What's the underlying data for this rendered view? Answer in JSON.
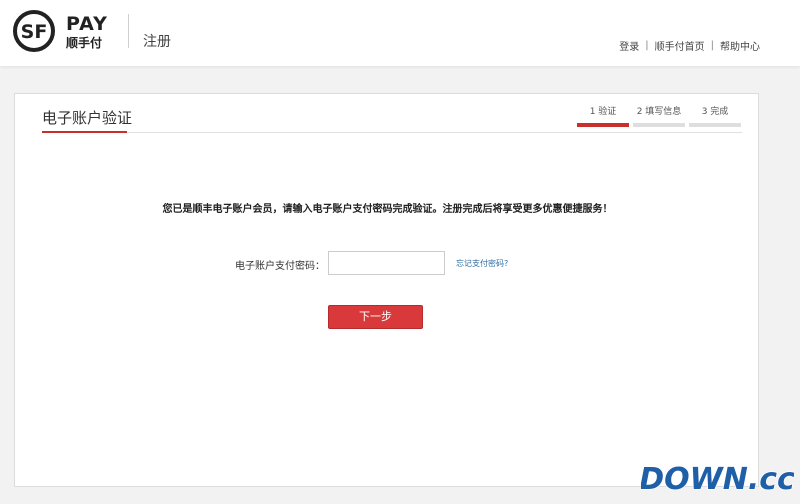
{
  "header": {
    "logo_text": "PAY",
    "logo_brand": "顺手付",
    "logo_mark": "SF",
    "page_name": "注册",
    "nav": [
      {
        "label": "登录"
      },
      {
        "label": "顺手付首页"
      },
      {
        "label": "帮助中心"
      }
    ],
    "nav_separator": "|"
  },
  "card": {
    "title": "电子账户验证",
    "steps": [
      {
        "label": "1 验证",
        "active": true
      },
      {
        "label": "2 填写信息",
        "active": false
      },
      {
        "label": "3 完成",
        "active": false
      }
    ],
    "notice": "您已是顺丰电子账户会员，请输入电子账户支付密码完成验证。注册完成后将享受更多优惠便捷服务！",
    "password_label": "电子账户支付密码：",
    "password_value": "",
    "password_placeholder": "",
    "forgot_link": "忘记支付密码?",
    "next_button": "下一步"
  },
  "watermark": {
    "text": "DOWN.cc"
  },
  "colors": {
    "accent": "#c9302c",
    "button": "#d9393a",
    "link": "#2e6da4",
    "page_bg": "#f2f2f2"
  }
}
